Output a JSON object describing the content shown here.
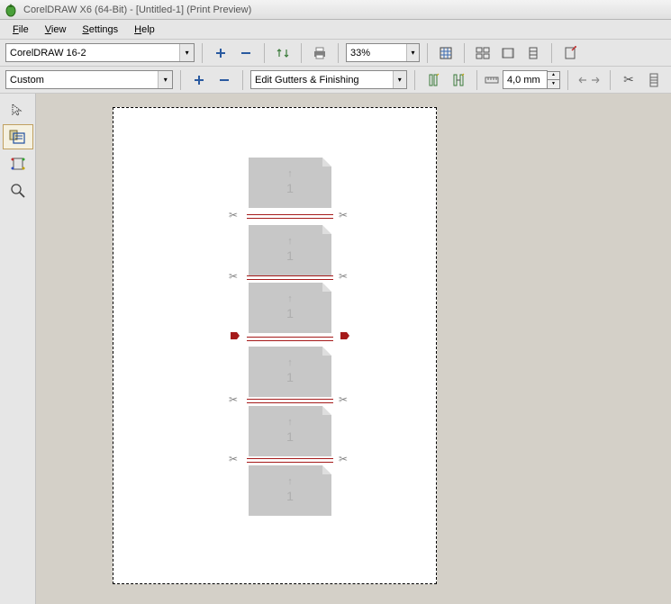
{
  "title": "CorelDRAW X6 (64-Bit) - [Untitled-1] (Print Preview)",
  "menu": {
    "file": "File",
    "view": "View",
    "settings": "Settings",
    "help": "Help"
  },
  "toolbar1": {
    "printerCombo": "CorelDRAW 16-2",
    "zoom": "33%"
  },
  "toolbar2": {
    "layoutCombo": "Custom",
    "gutterCombo": "Edit Gutters & Finishing",
    "spacing": "4,0 mm"
  },
  "pages": [
    {
      "n": "1"
    },
    {
      "n": "1"
    },
    {
      "n": "1"
    },
    {
      "n": "1"
    },
    {
      "n": "1"
    },
    {
      "n": "1"
    }
  ],
  "glyph": {
    "scissor": "✂",
    "up": "↑",
    "dd": "▾",
    "u": "▲",
    "d": "▼",
    "cx": "✕",
    "box": "▢",
    "tab": "▮",
    "ruler": "⊞"
  }
}
